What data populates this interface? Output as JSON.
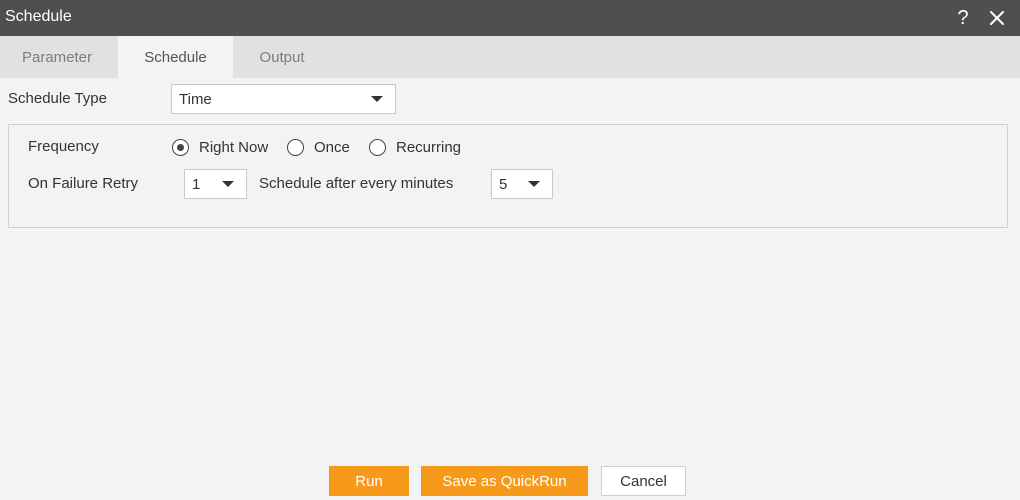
{
  "window": {
    "title": "Schedule",
    "help_icon": "?",
    "close_icon": "close-icon"
  },
  "tabs": [
    {
      "label": "Parameter",
      "active": false
    },
    {
      "label": "Schedule",
      "active": true
    },
    {
      "label": "Output",
      "active": false
    }
  ],
  "schedule_type": {
    "label": "Schedule Type",
    "value": "Time"
  },
  "frequency": {
    "label": "Frequency",
    "options": [
      {
        "label": "Right Now",
        "selected": true
      },
      {
        "label": "Once",
        "selected": false
      },
      {
        "label": "Recurring",
        "selected": false
      }
    ]
  },
  "retry": {
    "label": "On Failure Retry",
    "value": "1"
  },
  "interval": {
    "label": "Schedule after every minutes",
    "value": "5"
  },
  "buttons": {
    "run": "Run",
    "save_quickrun": "Save as QuickRun",
    "cancel": "Cancel"
  },
  "colors": {
    "titlebar": "#4f4f4f",
    "accent": "#f79a1c",
    "tabbar": "#e1e1e1",
    "background": "#f3f3f3"
  }
}
